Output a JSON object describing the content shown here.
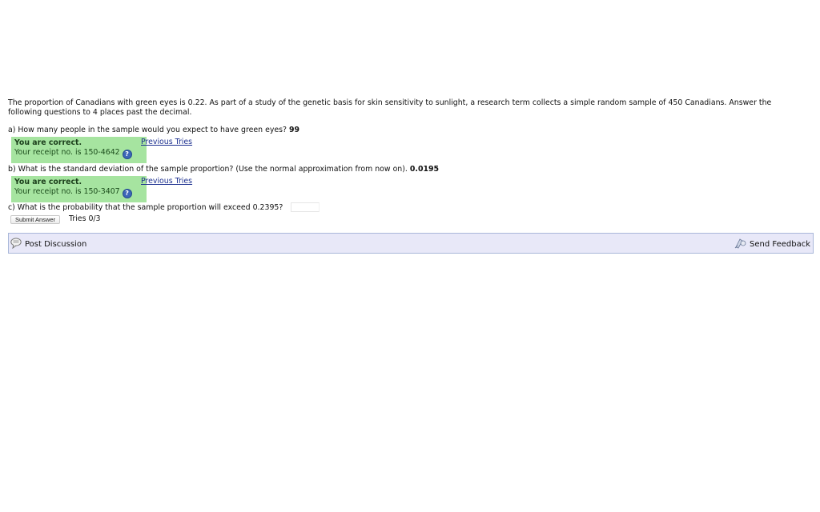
{
  "problem": {
    "intro": "The proportion of Canadians with green eyes is 0.22. As part of a study of the genetic basis for skin sensitivity to sunlight, a research term collects a simple random sample of 450 Canadians. Answer the following questions to 4 places past the decimal.",
    "part_a": {
      "question": "a) How many people in the sample would you expect to have green eyes?",
      "answer": "99",
      "status_title": "You are correct.",
      "receipt": "Your receipt no. is 150-4642",
      "previous_tries": "Previous Tries"
    },
    "part_b": {
      "question": "b) What is the standard deviation of the sample proportion? (Use the normal approximation from now on).",
      "answer": "0.0195",
      "status_title": "You are correct.",
      "receipt": "Your receipt no. is 150-3407",
      "previous_tries": "Previous Tries"
    },
    "part_c": {
      "question": "c) What is the probability that the sample proportion will exceed 0.2395?",
      "input_value": "",
      "submit_label": "Submit Answer",
      "tries": "Tries 0/3"
    }
  },
  "footer": {
    "post_discussion": "Post Discussion",
    "send_feedback": "Send Feedback"
  },
  "icons": {
    "help": "help-icon",
    "discussion": "discussion-icon",
    "feedback": "feedback-icon"
  },
  "colors": {
    "correct_bg": "#a6e4a0",
    "bar_bg": "#e8e8f8",
    "bar_border": "#a9b7d9",
    "link": "#1b2f8f"
  }
}
